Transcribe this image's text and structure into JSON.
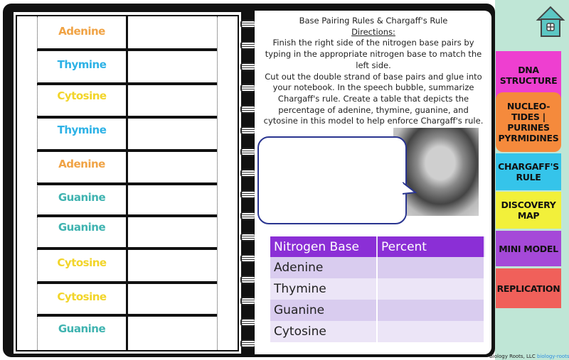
{
  "left_page": {
    "bases": [
      {
        "name": "Adenine",
        "color": "#f0a345"
      },
      {
        "name": "Thymine",
        "color": "#2eb2e6"
      },
      {
        "name": "Cytosine",
        "color": "#f2d52a"
      },
      {
        "name": "Thymine",
        "color": "#2eb2e6"
      },
      {
        "name": "Adenine",
        "color": "#f0a345"
      },
      {
        "name": "Guanine",
        "color": "#3fb3b0"
      },
      {
        "name": "Guanine",
        "color": "#3fb3b0"
      },
      {
        "name": "Cytosine",
        "color": "#f2d52a"
      },
      {
        "name": "Cytosine",
        "color": "#f2d52a"
      },
      {
        "name": "Guanine",
        "color": "#3fb3b0"
      }
    ]
  },
  "right_page": {
    "title": "Base Pairing Rules & Chargaff's Rule",
    "directions_label": "Directions:",
    "para1": "Finish the right side of the nitrogen base pairs by typing in the appropriate nitrogen base to match the left side.",
    "para2": "Cut out the double strand of base pairs and glue into your notebook. In the speech bubble, summarize Chargaff's rule. Create a table that depicts the percentage of adenine, thymine, guanine, and cytosine in this model to help enforce Chargaff's rule.",
    "table": {
      "headers": [
        "Nitrogen Base",
        "Percent"
      ],
      "rows": [
        [
          "Adenine",
          ""
        ],
        [
          "Thymine",
          ""
        ],
        [
          "Guanine",
          ""
        ],
        [
          "Cytosine",
          ""
        ]
      ],
      "header_color": "#8b2fd6"
    }
  },
  "sidebar": {
    "home_icon": "house-icon",
    "tabs": [
      {
        "label": "DNA STRUCTURE",
        "color": "#ee3fd0"
      },
      {
        "label": "NUCLEO- TIDES | PURINES PYRMIDINES",
        "color": "#f58a3c"
      },
      {
        "label": "CHARGAFF'S RULE",
        "color": "#35c4ea"
      },
      {
        "label": "DISCOVERY MAP",
        "color": "#f2f03a"
      },
      {
        "label": "MINI MODEL",
        "color": "#a549d8"
      },
      {
        "label": "REPLICATION",
        "color": "#f0605a"
      }
    ]
  },
  "footer": {
    "company": "Biology Roots, LLC",
    "site": "biology-roots.com"
  }
}
